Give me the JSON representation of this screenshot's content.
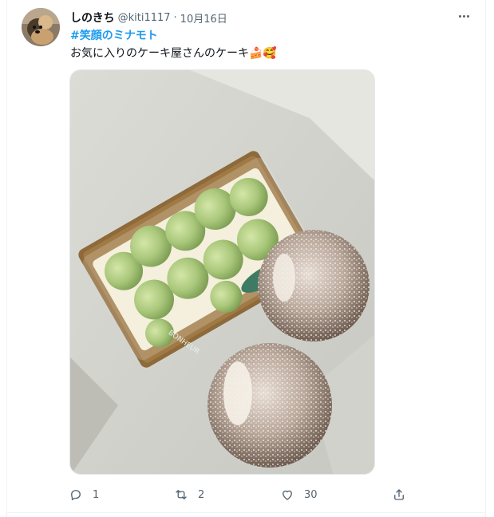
{
  "tweet": {
    "display_name": "しのきち",
    "handle": "@kiti1117",
    "separator": "·",
    "date": "10月16日",
    "hashtag": "#笑顔のミナモト",
    "text": "お気に入りのケーキ屋さんのケーキ",
    "emojis": "🍰🥰",
    "photo_label": "BONHEUR"
  },
  "actions": {
    "reply_count": "1",
    "retweet_count": "2",
    "like_count": "30"
  },
  "colors": {
    "accent": "#1d9bf0",
    "secondary_text": "#536471",
    "primary_text": "#0f1419",
    "border": "#eff3f4"
  },
  "icons": [
    "more-icon",
    "reply-icon",
    "retweet-icon",
    "like-icon",
    "share-icon"
  ]
}
